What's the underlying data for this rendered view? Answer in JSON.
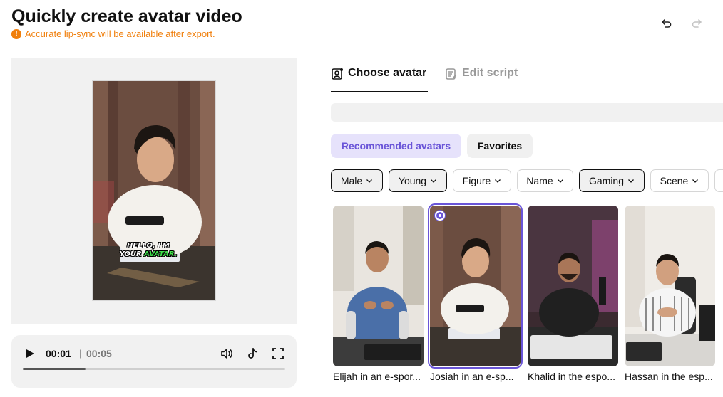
{
  "header": {
    "title": "Quickly create avatar video",
    "notice": "Accurate lip-sync will be available after export.",
    "notice_icon": "warning-icon",
    "undo_icon": "undo-icon",
    "redo_icon": "redo-icon"
  },
  "preview": {
    "caption_line1": "HELLO, I'M",
    "caption_line2_a": "YOUR ",
    "caption_line2_b": "AVATAR."
  },
  "player": {
    "current_time": "00:01",
    "separator": "|",
    "total_time": "00:05",
    "progress": 0.24,
    "icons": [
      "play-icon",
      "volume-icon",
      "tiktok-icon",
      "fullscreen-icon"
    ]
  },
  "tabs": [
    {
      "label": "Choose avatar",
      "icon": "avatar-icon",
      "active": true
    },
    {
      "label": "Edit script",
      "icon": "script-icon",
      "active": false
    }
  ],
  "categories": [
    {
      "label": "Recommended avatars",
      "active": true
    },
    {
      "label": "Favorites",
      "active": false
    }
  ],
  "filters": [
    {
      "label": "Male",
      "active": true
    },
    {
      "label": "Young",
      "active": true
    },
    {
      "label": "Figure",
      "active": false
    },
    {
      "label": "Name",
      "active": false
    },
    {
      "label": "Gaming",
      "active": true
    },
    {
      "label": "Scene",
      "active": false
    }
  ],
  "avatars": [
    {
      "label": "Elijah in an e-spor...",
      "selected": false
    },
    {
      "label": "Josiah in an e-sp...",
      "selected": true
    },
    {
      "label": "Khalid in the espo...",
      "selected": false
    },
    {
      "label": "Hassan in the esp...",
      "selected": false
    }
  ],
  "colors": {
    "accent": "#6a55d8",
    "warning": "#f07f0c",
    "caption_highlight": "#3ee04a"
  }
}
